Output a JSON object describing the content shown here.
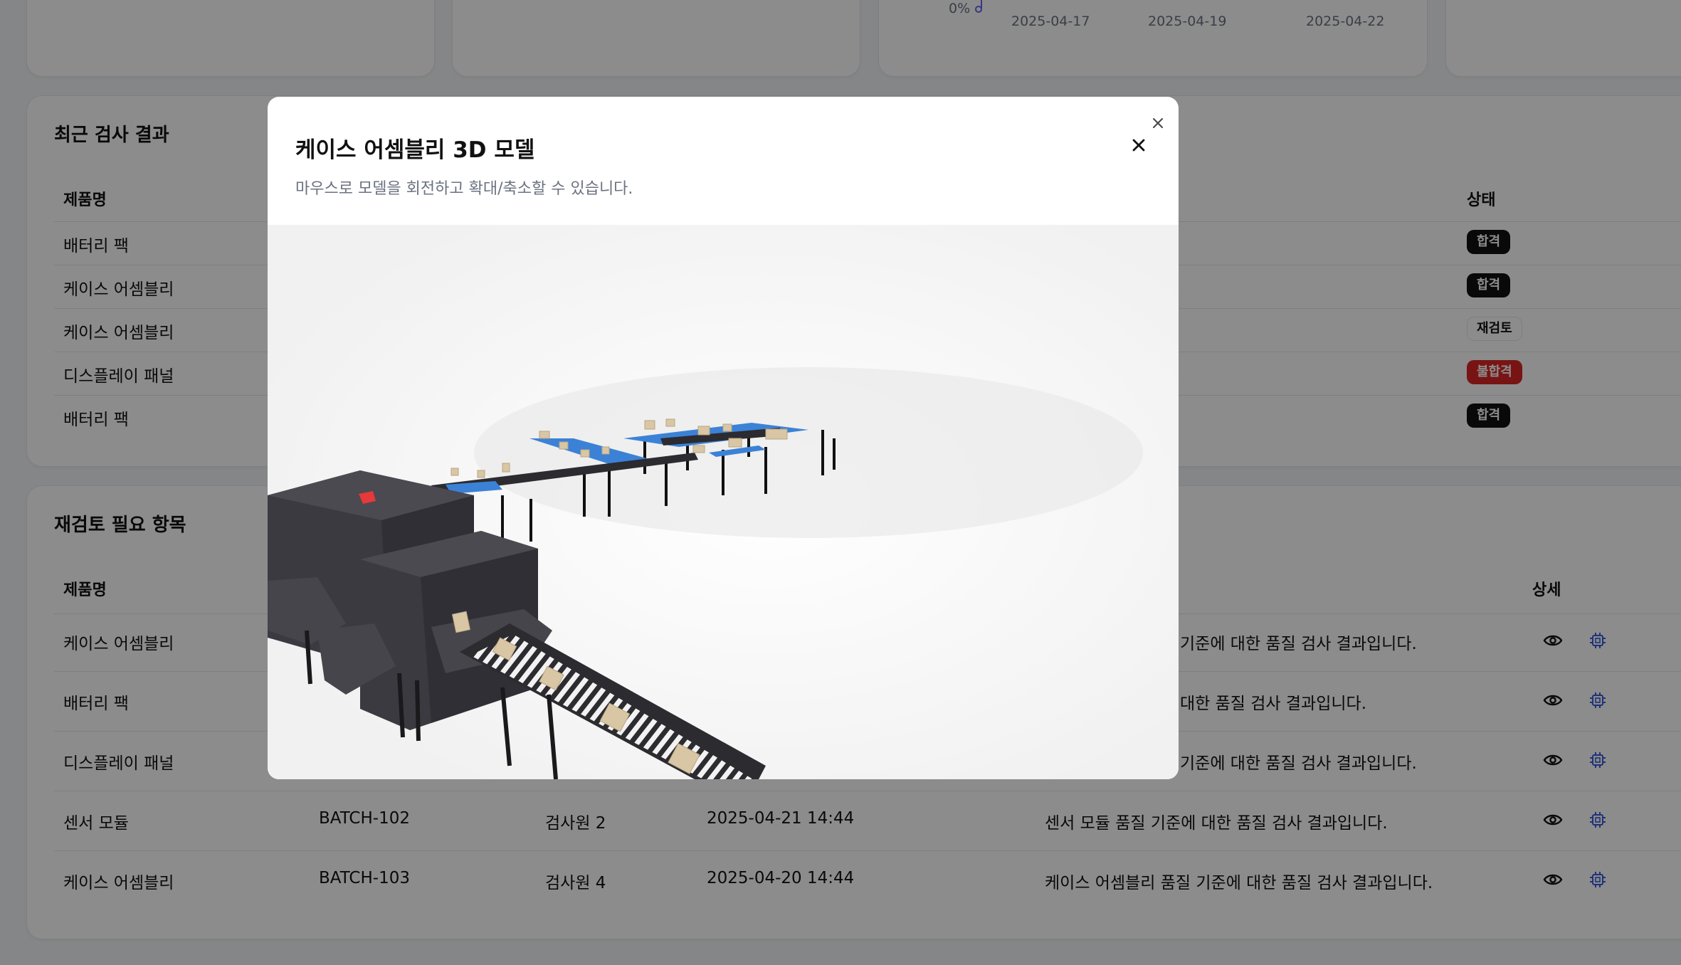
{
  "top_chart": {
    "y_tick": "0%",
    "x_ticks": [
      "2025-04-17",
      "2025-04-19",
      "2025-04-22"
    ]
  },
  "recent": {
    "title": "최근 검사 결과",
    "headers": {
      "product": "제품명",
      "status": "상태"
    },
    "rows": [
      {
        "product": "배터리 팩",
        "status": "합격",
        "kind": "pass"
      },
      {
        "product": "케이스 어셈블리",
        "status": "합격",
        "kind": "pass"
      },
      {
        "product": "케이스 어셈블리",
        "status": "재검토",
        "kind": "review"
      },
      {
        "product": "디스플레이 패널",
        "status": "불합격",
        "kind": "fail"
      },
      {
        "product": "배터리 팩",
        "status": "합격",
        "kind": "pass"
      }
    ]
  },
  "review": {
    "title": "재검토 필요 항목",
    "headers": {
      "product": "제품명",
      "detail": "상세"
    },
    "rows": [
      {
        "product": "케이스 어셈블리",
        "batch": "",
        "inspector": "",
        "datetime": "",
        "description": "기준에 대한 품질 검사 결과입니다."
      },
      {
        "product": "배터리 팩",
        "batch": "",
        "inspector": "",
        "datetime": "",
        "description": "대한 품질 검사 결과입니다."
      },
      {
        "product": "디스플레이 패널",
        "batch": "",
        "inspector": "",
        "datetime": "",
        "description": "기준에 대한 품질 검사 결과입니다."
      },
      {
        "product": "센서 모듈",
        "batch": "BATCH-102",
        "inspector": "검사원 2",
        "datetime": "2025-04-21 14:44",
        "description": "센서 모듈 품질 기준에 대한 품질 검사 결과입니다."
      },
      {
        "product": "케이스 어셈블리",
        "batch": "BATCH-103",
        "inspector": "검사원 4",
        "datetime": "2025-04-20 14:44",
        "description": "케이스 어셈블리 품질 기준에 대한 품질 검사 결과입니다."
      }
    ],
    "icons": [
      "eye-icon",
      "cpu-chip-icon"
    ]
  },
  "modal": {
    "title": "케이스 어셈블리 3D 모델",
    "description": "마우스로 모델을 회전하고 확대/축소할 수 있습니다."
  },
  "colors": {
    "pass_badge": "#111111",
    "fail_badge": "#dc2626",
    "accent_icon": "#3b5bdb",
    "conveyor_blue": "#3b82d6",
    "machine_dark": "#3a3a40",
    "box_tan": "#d9c6a5"
  }
}
